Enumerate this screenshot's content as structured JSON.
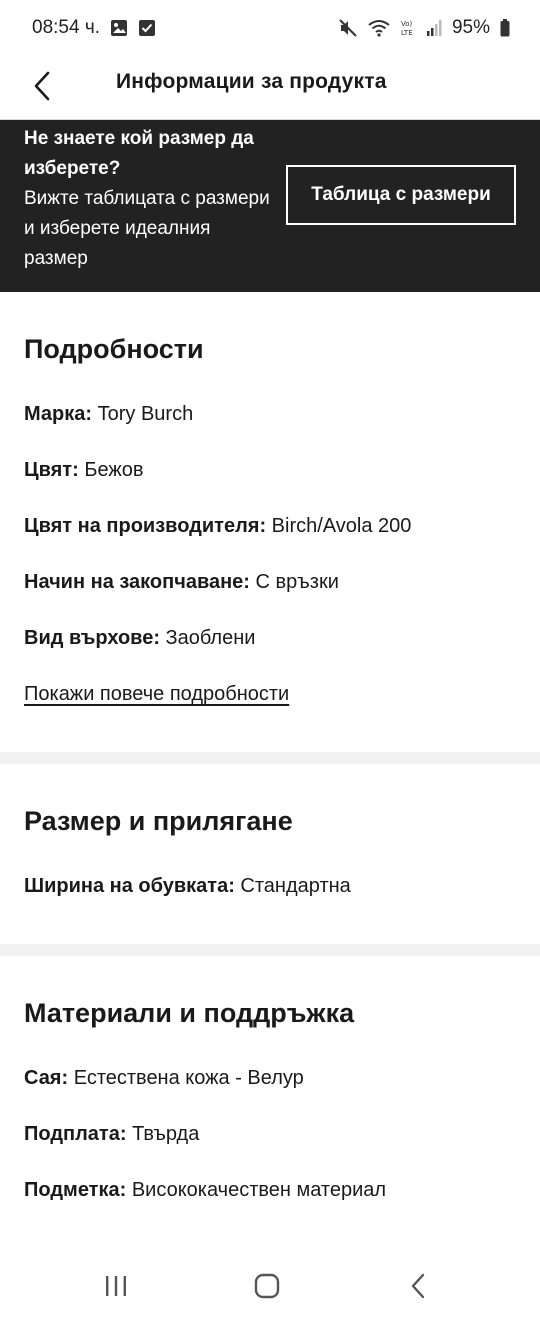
{
  "status_bar": {
    "time": "08:54 ч.",
    "battery": "95%",
    "icons": [
      "gallery-icon",
      "check-box-icon",
      "mute-icon",
      "wifi-icon",
      "volte-icon",
      "signal-icon",
      "battery-icon"
    ]
  },
  "header": {
    "title": "Информации за продукта",
    "back_icon": "chevron-left-icon"
  },
  "size_banner": {
    "heading": "Не знаете кой размер да изберете?",
    "subtext": "Вижте таблицата с размери и изберете идеалния размер",
    "button_label": "Таблица с размери"
  },
  "details": {
    "title": "Подробности",
    "rows": [
      {
        "key": "Марка:",
        "value": "Tory Burch"
      },
      {
        "key": "Цвят:",
        "value": "Бежов"
      },
      {
        "key": "Цвят на производителя:",
        "value": "Birch/Avola 200"
      },
      {
        "key": "Начин на закопчаване:",
        "value": "С връзки"
      },
      {
        "key": "Вид върхове:",
        "value": "Заоблени"
      }
    ],
    "more_link": "Покажи повече подробности"
  },
  "size_fit": {
    "title": "Размер и прилягане",
    "rows": [
      {
        "key": "Ширина на обувката:",
        "value": "Стандартна"
      }
    ]
  },
  "materials": {
    "title": "Материали и поддръжка",
    "rows": [
      {
        "key": "Сая:",
        "value": "Естествена кожа - Велур"
      },
      {
        "key": "Подплата:",
        "value": "Твърда"
      },
      {
        "key": "Подметка:",
        "value": "Висококачествен материал"
      }
    ]
  },
  "colors": {
    "banner_bg": "#222222",
    "divider": "#f2f2f2",
    "text": "#1a1a1a"
  }
}
